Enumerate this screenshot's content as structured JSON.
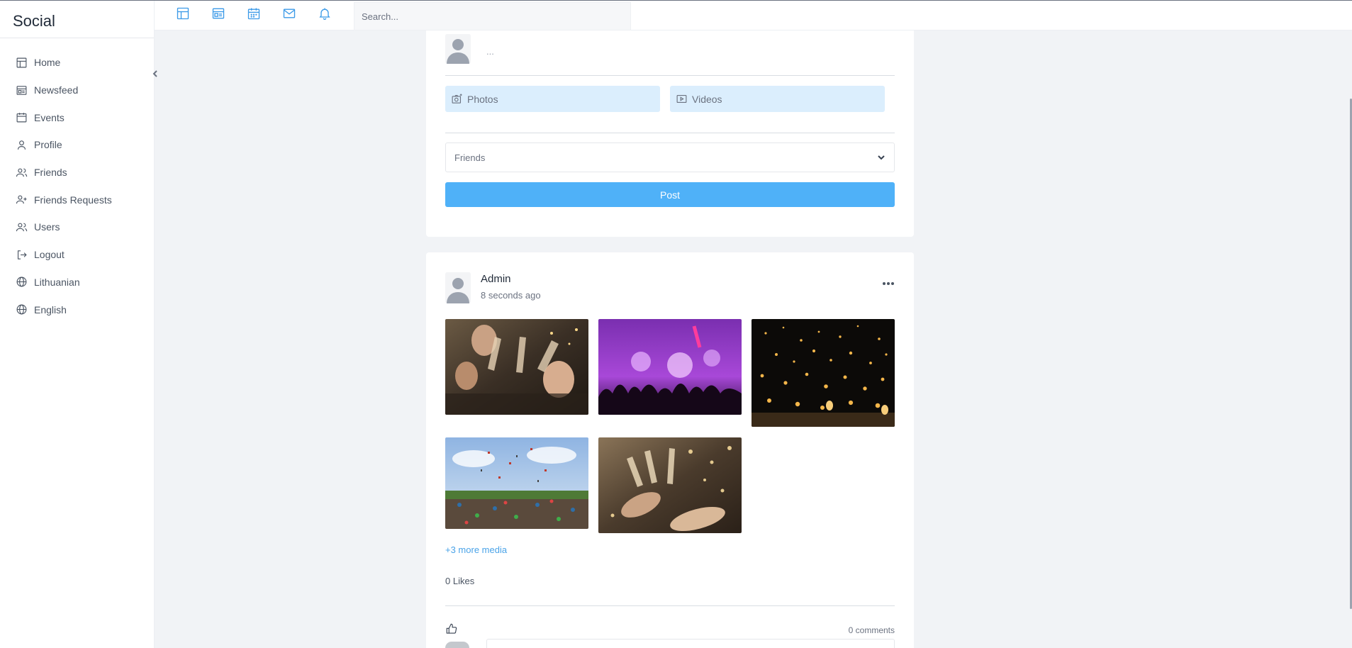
{
  "app": {
    "brand": "Social"
  },
  "sidebar": {
    "items": [
      {
        "label": "Home",
        "icon": "layout-icon"
      },
      {
        "label": "Newsfeed",
        "icon": "newsfeed-icon"
      },
      {
        "label": "Events",
        "icon": "calendar-icon"
      },
      {
        "label": "Profile",
        "icon": "user-icon"
      },
      {
        "label": "Friends",
        "icon": "users-icon"
      },
      {
        "label": "Friends Requests",
        "icon": "user-plus-icon"
      },
      {
        "label": "Users",
        "icon": "users-icon"
      },
      {
        "label": "Logout",
        "icon": "logout-icon"
      },
      {
        "label": "Lithuanian",
        "icon": "globe-icon"
      },
      {
        "label": "English",
        "icon": "globe-icon"
      }
    ]
  },
  "topbar": {
    "icons": [
      "layout-icon",
      "newsfeed-icon",
      "calendar-icon",
      "mail-icon",
      "bell-icon"
    ],
    "search_placeholder": "Search..."
  },
  "composer": {
    "text": "...",
    "photos_label": "Photos",
    "videos_label": "Videos",
    "audience_value": "Friends",
    "post_label": "Post"
  },
  "post": {
    "author": "Admin",
    "time": "8 seconds ago",
    "more_media": "+3 more media",
    "likes": "0 Likes",
    "comments": "0 comments"
  },
  "colors": {
    "accent": "#4fb1f8",
    "icon_blue": "#3b9ae8",
    "media_button_bg": "#dbeefd",
    "page_bg": "#f1f3f6"
  }
}
